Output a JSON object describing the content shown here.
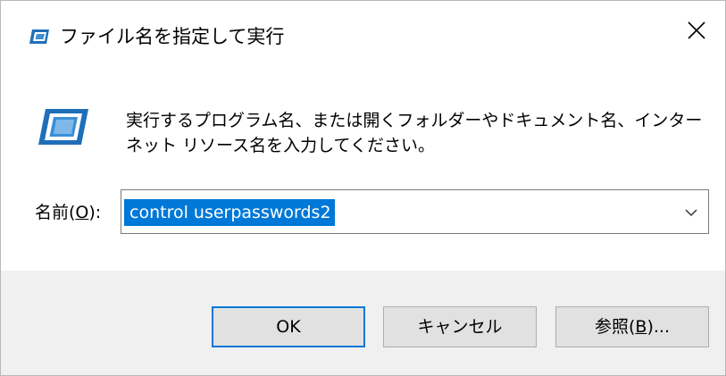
{
  "window": {
    "title": "ファイル名を指定して実行",
    "title_icon": "run-dialog-icon",
    "close_icon": "close-icon"
  },
  "dialog": {
    "icon": "run-dialog-icon",
    "message_line1": "実行するプログラム名、または開くフォルダーやドキュメント名、インター",
    "message_line2": "ネット リソース名を入力してください。",
    "name_label_prefix": "名前(",
    "name_label_mnemonic": "O",
    "name_label_suffix": "):",
    "input_value": "control userpasswords2",
    "dropdown_icon": "chevron-down-icon"
  },
  "buttons": {
    "ok": "OK",
    "cancel": "キャンセル",
    "browse_prefix": "参照(",
    "browse_mnemonic": "B",
    "browse_suffix": ")..."
  },
  "colors": {
    "accent": "#0078d7",
    "footer_bg": "#f0f0f0",
    "button_bg": "#e1e1e1"
  }
}
